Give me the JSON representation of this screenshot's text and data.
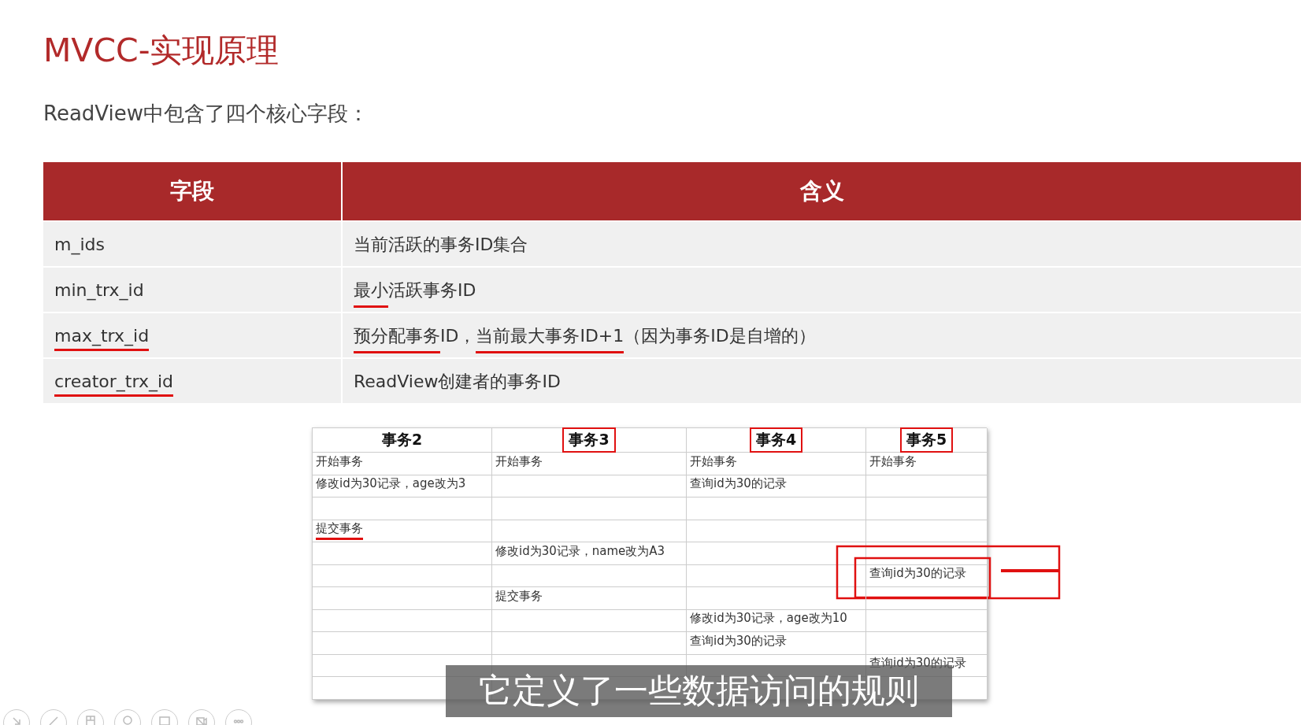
{
  "slide": {
    "title": "MVCC-实现原理",
    "intro": "ReadView中包含了四个核心字段：",
    "fields_table": {
      "columns": [
        "字段",
        "含义"
      ],
      "rows": [
        {
          "field": {
            "text": "m_ids",
            "underlined": false
          },
          "meaning": [
            {
              "text": "当前活跃的事务ID集合",
              "underlined": false
            }
          ]
        },
        {
          "field": {
            "text": "min_trx_id",
            "underlined": false
          },
          "meaning": [
            {
              "text": "最小",
              "underlined": true
            },
            {
              "text": "活跃事务ID",
              "underlined": false
            }
          ]
        },
        {
          "field": {
            "text": "max_trx_id",
            "underlined": true
          },
          "meaning": [
            {
              "text": "预分配事务",
              "underlined": true
            },
            {
              "text": "ID，",
              "underlined": false
            },
            {
              "text": "当前最大事务ID+1",
              "underlined": true
            },
            {
              "text": "（因为事务ID是自增的）",
              "underlined": false
            }
          ]
        },
        {
          "field": {
            "text": "creator_trx_id",
            "underlined": true
          },
          "meaning": [
            {
              "text": "ReadView创建者的事务ID",
              "underlined": false
            }
          ]
        }
      ]
    },
    "transactions_table": {
      "columns": [
        {
          "label": "事务2",
          "boxed": false
        },
        {
          "label": "事务3",
          "boxed": true
        },
        {
          "label": "事务4",
          "boxed": true
        },
        {
          "label": "事务5",
          "boxed": true
        }
      ],
      "rows": [
        [
          {
            "text": "开始事务"
          },
          {
            "text": "开始事务"
          },
          {
            "text": "开始事务"
          },
          {
            "text": "开始事务"
          }
        ],
        [
          {
            "text": "修改id为30记录，age改为3"
          },
          {
            "text": ""
          },
          {
            "text": "查询id为30的记录"
          },
          {
            "text": ""
          }
        ],
        [
          {
            "text": ""
          },
          {
            "text": ""
          },
          {
            "text": ""
          },
          {
            "text": ""
          }
        ],
        [
          {
            "text": "提交事务",
            "underlined": true
          },
          {
            "text": ""
          },
          {
            "text": ""
          },
          {
            "text": ""
          }
        ],
        [
          {
            "text": ""
          },
          {
            "text": "修改id为30记录，name改为A3"
          },
          {
            "text": ""
          },
          {
            "text": ""
          }
        ],
        [
          {
            "text": ""
          },
          {
            "text": ""
          },
          {
            "text": ""
          },
          {
            "text": "查询id为30的记录",
            "boxed": true
          }
        ],
        [
          {
            "text": ""
          },
          {
            "text": "提交事务"
          },
          {
            "text": ""
          },
          {
            "text": ""
          }
        ],
        [
          {
            "text": ""
          },
          {
            "text": ""
          },
          {
            "text": "修改id为30记录，age改为10"
          },
          {
            "text": ""
          }
        ],
        [
          {
            "text": ""
          },
          {
            "text": ""
          },
          {
            "text": "查询id为30的记录"
          },
          {
            "text": ""
          }
        ],
        [
          {
            "text": ""
          },
          {
            "text": ""
          },
          {
            "text": ""
          },
          {
            "text": "查询id为30的记录"
          }
        ],
        [
          {
            "text": ""
          },
          {
            "text": ""
          },
          {
            "text": ""
          },
          {
            "text": ""
          }
        ]
      ]
    }
  },
  "subtitle": "它定义了一些数据访问的规则",
  "toolbar": {
    "buttons": [
      {
        "kind": "arrow"
      },
      {
        "kind": "pen"
      },
      {
        "kind": "slides"
      },
      {
        "kind": "zoom"
      },
      {
        "kind": "screen"
      },
      {
        "kind": "camera"
      },
      {
        "kind": "more"
      }
    ]
  }
}
